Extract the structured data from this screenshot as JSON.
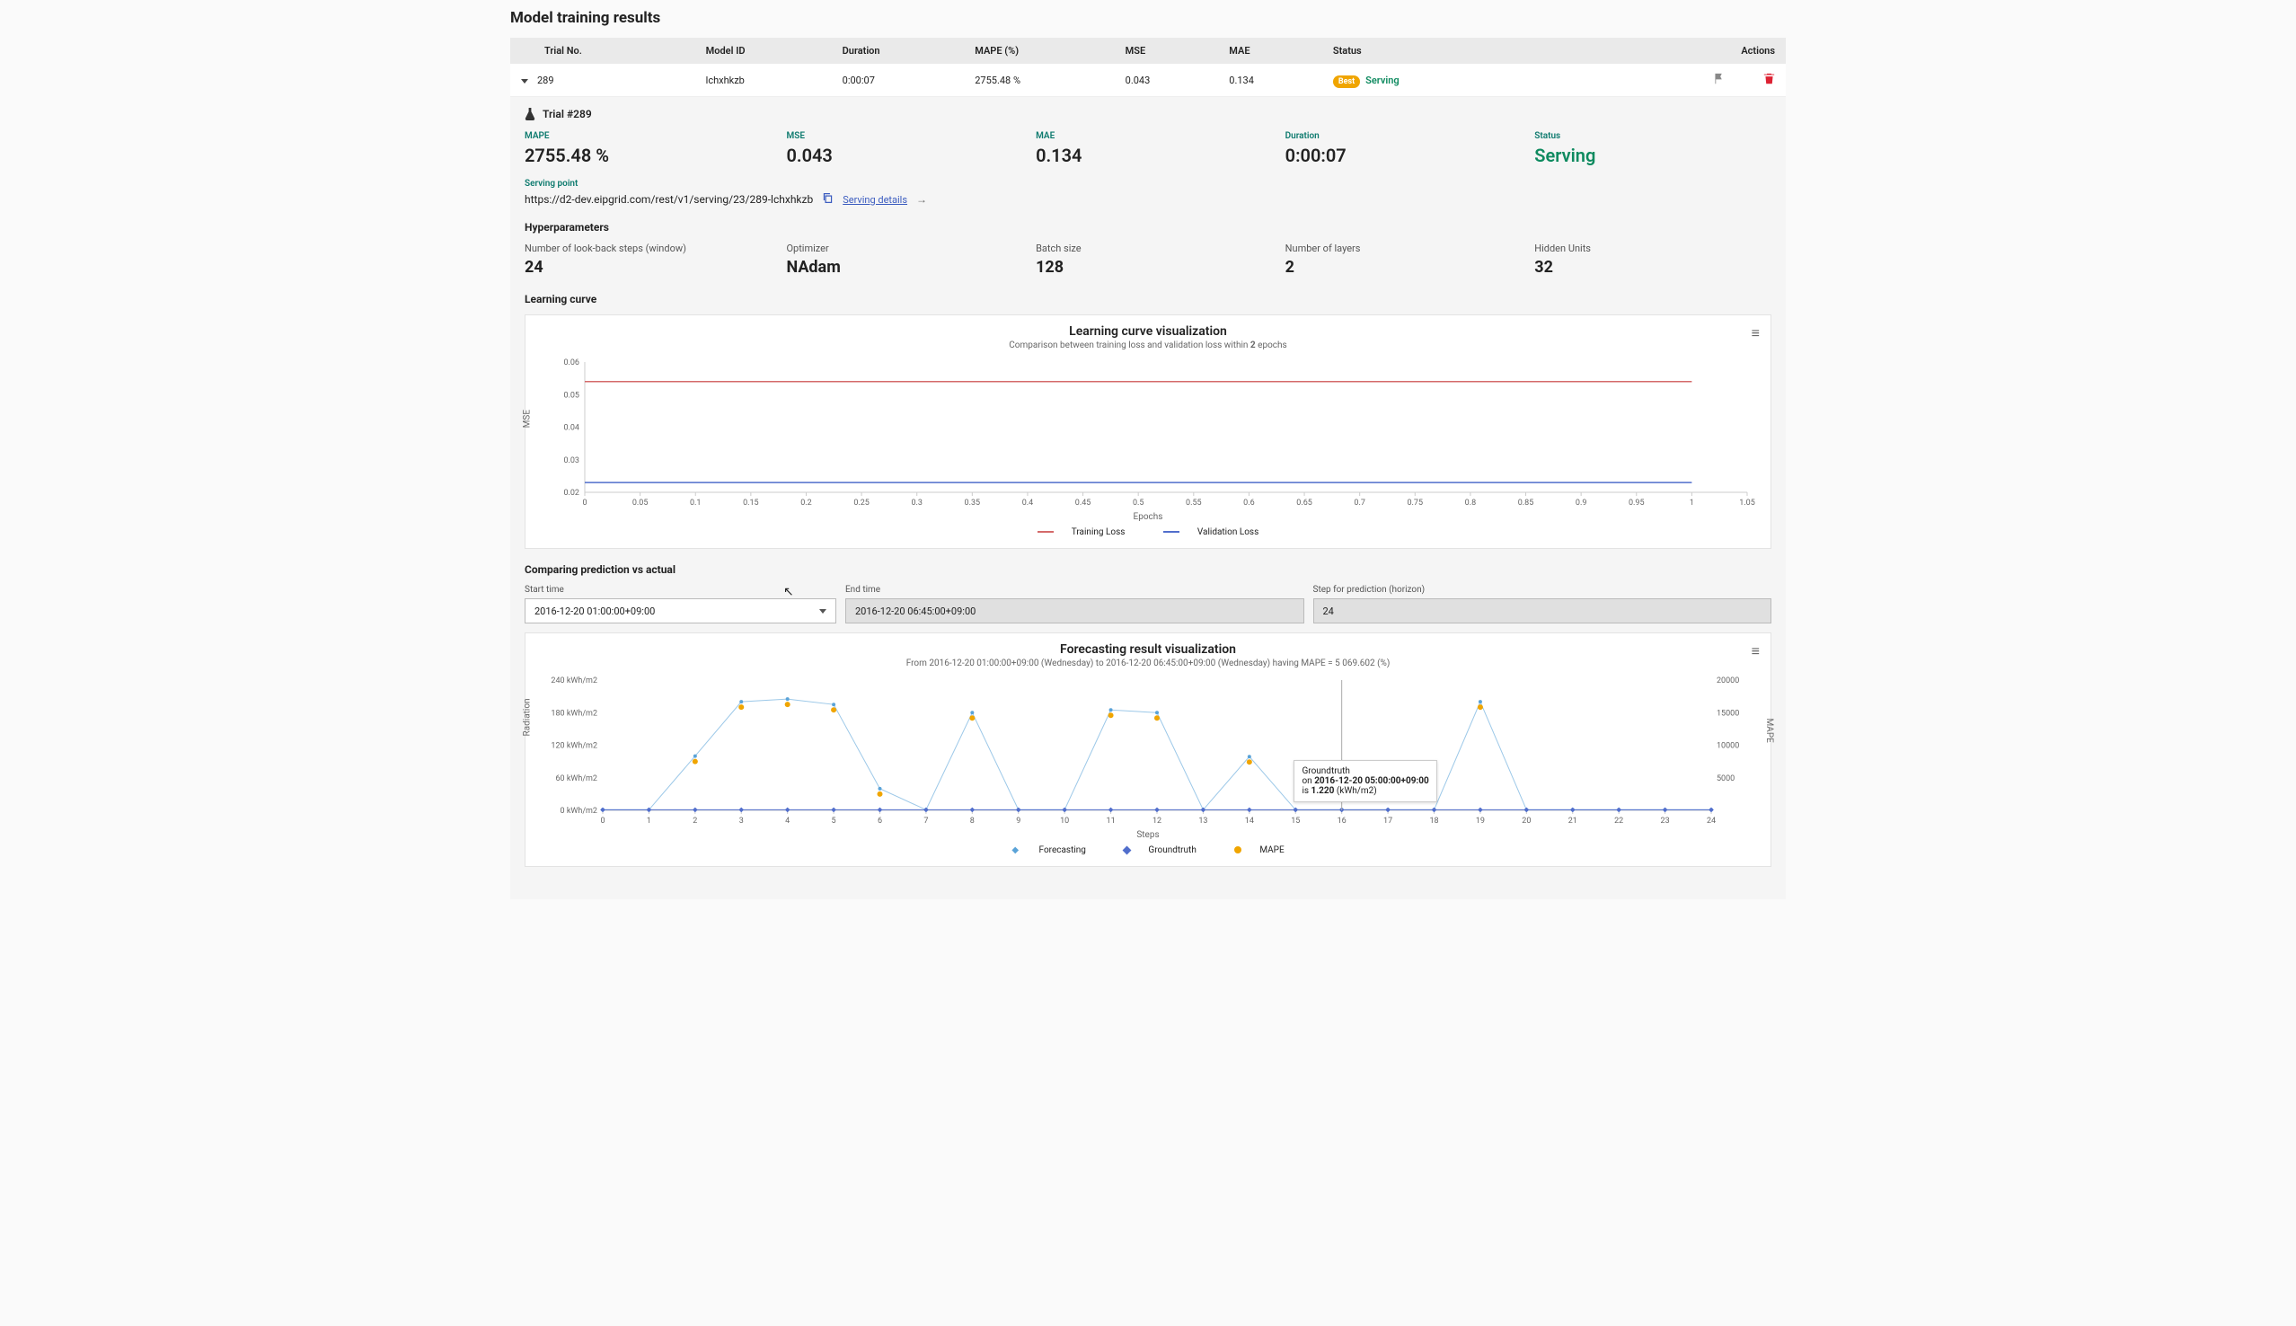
{
  "page_title": "Model training results",
  "table": {
    "headers": [
      "Trial No.",
      "Model ID",
      "Duration",
      "MAPE (%)",
      "MSE",
      "MAE",
      "Status",
      "Actions"
    ],
    "row": {
      "trial_no": "289",
      "model_id": "lchxhkzb",
      "duration": "0:00:07",
      "mape": "2755.48 %",
      "mse": "0.043",
      "mae": "0.134",
      "badge": "Best",
      "status": "Serving"
    }
  },
  "detail": {
    "trial_title": "Trial #289",
    "metrics": {
      "mape_label": "MAPE",
      "mape": "2755.48 %",
      "mse_label": "MSE",
      "mse": "0.043",
      "mae_label": "MAE",
      "mae": "0.134",
      "duration_label": "Duration",
      "duration": "0:00:07",
      "status_label": "Status",
      "status": "Serving"
    },
    "serving": {
      "label": "Serving point",
      "url": "https://d2-dev.eipgrid.com/rest/v1/serving/23/289-lchxhkzb",
      "details": "Serving details"
    },
    "hyper_title": "Hyperparameters",
    "hyper": {
      "window_label": "Number of look-back steps (window)",
      "window": "24",
      "optimizer_label": "Optimizer",
      "optimizer": "NAdam",
      "batch_label": "Batch size",
      "batch": "128",
      "layers_label": "Number of layers",
      "layers": "2",
      "hidden_label": "Hidden Units",
      "hidden": "32"
    }
  },
  "learning_curve": {
    "section": "Learning curve",
    "title": "Learning curve visualization",
    "subtitle_prefix": "Comparison between training loss and validation loss within ",
    "epochs": "2",
    "subtitle_suffix": " epochs",
    "xlabel": "Epochs",
    "legend": {
      "train": "Training Loss",
      "val": "Validation Loss"
    }
  },
  "compare": {
    "section": "Comparing prediction vs actual",
    "start_label": "Start time",
    "start_value": "2016-12-20 01:00:00+09:00",
    "end_label": "End time",
    "end_value": "2016-12-20 06:45:00+09:00",
    "step_label": "Step for prediction (horizon)",
    "step_value": "24"
  },
  "forecast": {
    "title": "Forecasting result visualization",
    "subtitle": "From 2016-12-20 01:00:00+09:00 (Wednesday) to 2016-12-20 06:45:00+09:00 (Wednesday) having MAPE = 5 069.602 (%)",
    "xlabel": "Steps",
    "legend": {
      "f": "Forecasting",
      "g": "Groundtruth",
      "m": "MAPE"
    },
    "tooltip": {
      "name": "Groundtruth",
      "line1a": "on ",
      "line1b": "2016-12-20 05:00:00+09:00",
      "line2a": "is ",
      "line2b": "1.220",
      "line2c": " (kWh/m2)"
    }
  },
  "chart_data": [
    {
      "type": "line",
      "title": "Learning curve visualization",
      "xlabel": "Epochs",
      "ylabel": "MSE",
      "ylim": [
        0.02,
        0.06
      ],
      "x_ticks": [
        0,
        0.05,
        0.1,
        0.15,
        0.2,
        0.25,
        0.3,
        0.35,
        0.4,
        0.45,
        0.5,
        0.55,
        0.6,
        0.65,
        0.7,
        0.75,
        0.8,
        0.85,
        0.9,
        0.95,
        1,
        1.05
      ],
      "y_ticks": [
        0.02,
        0.03,
        0.04,
        0.05,
        0.06
      ],
      "series": [
        {
          "name": "Training Loss",
          "color": "#d46a6a",
          "x": [
            0,
            1
          ],
          "y": [
            0.054,
            0.054
          ]
        },
        {
          "name": "Validation Loss",
          "color": "#516ecc",
          "x": [
            0,
            1
          ],
          "y": [
            0.023,
            0.023
          ]
        }
      ]
    },
    {
      "type": "line",
      "title": "Forecasting result visualization",
      "xlabel": "Steps",
      "ylabel": "Radiation",
      "y2label": "MAPE",
      "ylim": [
        0,
        240
      ],
      "y2lim": [
        0,
        20000
      ],
      "x_ticks": [
        0,
        1,
        2,
        3,
        4,
        5,
        6,
        7,
        8,
        9,
        10,
        11,
        12,
        13,
        14,
        15,
        16,
        17,
        18,
        19,
        20,
        21,
        22,
        23,
        24
      ],
      "y_ticks_labels": [
        "0 kWh/m2",
        "60 kWh/m2",
        "120 kWh/m2",
        "180 kWh/m2",
        "240 kWh/m2"
      ],
      "y2_ticks": [
        5000,
        10000,
        15000,
        20000
      ],
      "series": [
        {
          "name": "Forecasting",
          "color": "#5aa3d8",
          "x": [
            0,
            1,
            2,
            3,
            4,
            5,
            6,
            7,
            8,
            9,
            10,
            11,
            12,
            13,
            14,
            15,
            16,
            17,
            18,
            19,
            20,
            21,
            22,
            23,
            24
          ],
          "y": [
            1,
            1,
            100,
            200,
            205,
            195,
            40,
            1,
            180,
            1,
            1,
            185,
            180,
            1,
            99,
            1,
            1,
            1,
            1,
            200,
            1,
            1,
            1,
            1,
            1
          ]
        },
        {
          "name": "Groundtruth",
          "color": "#516ecc",
          "x": [
            0,
            1,
            2,
            3,
            4,
            5,
            6,
            7,
            8,
            9,
            10,
            11,
            12,
            13,
            14,
            15,
            16,
            17,
            18,
            19,
            20,
            21,
            22,
            23,
            24
          ],
          "y": [
            1,
            1,
            1,
            1,
            1,
            1,
            1,
            1,
            1,
            1,
            1,
            1,
            1,
            1,
            1,
            1,
            1,
            1,
            1,
            1,
            1,
            1,
            1,
            1,
            1
          ]
        },
        {
          "name": "MAPE",
          "color": "#f0a500",
          "axis": "y2",
          "x": [
            0,
            1,
            2,
            3,
            4,
            5,
            6,
            7,
            8,
            9,
            10,
            11,
            12,
            13,
            14,
            15,
            16,
            17,
            18,
            19,
            20,
            21,
            22,
            23,
            24
          ],
          "y": [
            0,
            0,
            8000,
            16500,
            16800,
            16000,
            3100,
            0,
            15000,
            0,
            0,
            15200,
            14700,
            0,
            8000,
            0,
            0,
            0,
            0,
            17000,
            0,
            0,
            0,
            0,
            0
          ]
        }
      ],
      "tooltip": {
        "series": "Groundtruth",
        "x_display": "2016-12-20 05:00:00+09:00",
        "value": 1.22,
        "unit": "kWh/m2",
        "step": 16
      }
    }
  ]
}
